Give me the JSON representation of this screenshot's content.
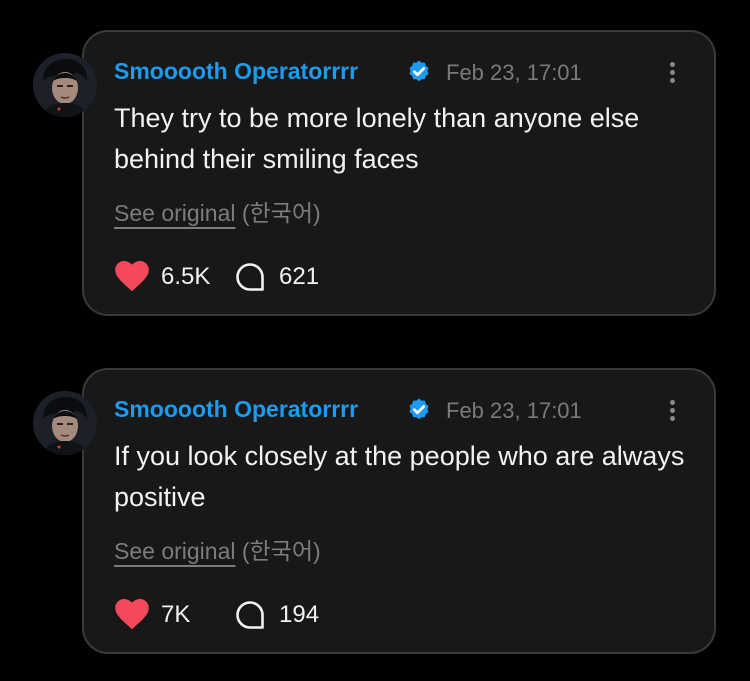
{
  "posts": [
    {
      "author": "Smooooth Operatorrrr",
      "timestamp": "Feb 23, 17:01",
      "text": "They try to be more lonely than anyone else behind their smiling faces",
      "see_original": "See original",
      "language": "(한국어)",
      "likes": "6.5K",
      "comments": "621"
    },
    {
      "author": "Smooooth Operatorrrr",
      "timestamp": "Feb 23, 17:01",
      "text": "If you look closely at the people who are always positive",
      "see_original": "See original",
      "language": "(한국어)",
      "likes": "7K",
      "comments": "194"
    }
  ],
  "icons": {
    "verified": "verified-badge-icon",
    "more": "more-options-icon",
    "like": "heart-icon",
    "comment": "comment-bubble-icon"
  },
  "colors": {
    "background": "#000000",
    "card": "#181818",
    "card_border": "#3a3a3a",
    "author": "#1d9bf0",
    "heart": "#f4485b",
    "muted": "#7a7a7a",
    "text": "#f2f2f2"
  }
}
